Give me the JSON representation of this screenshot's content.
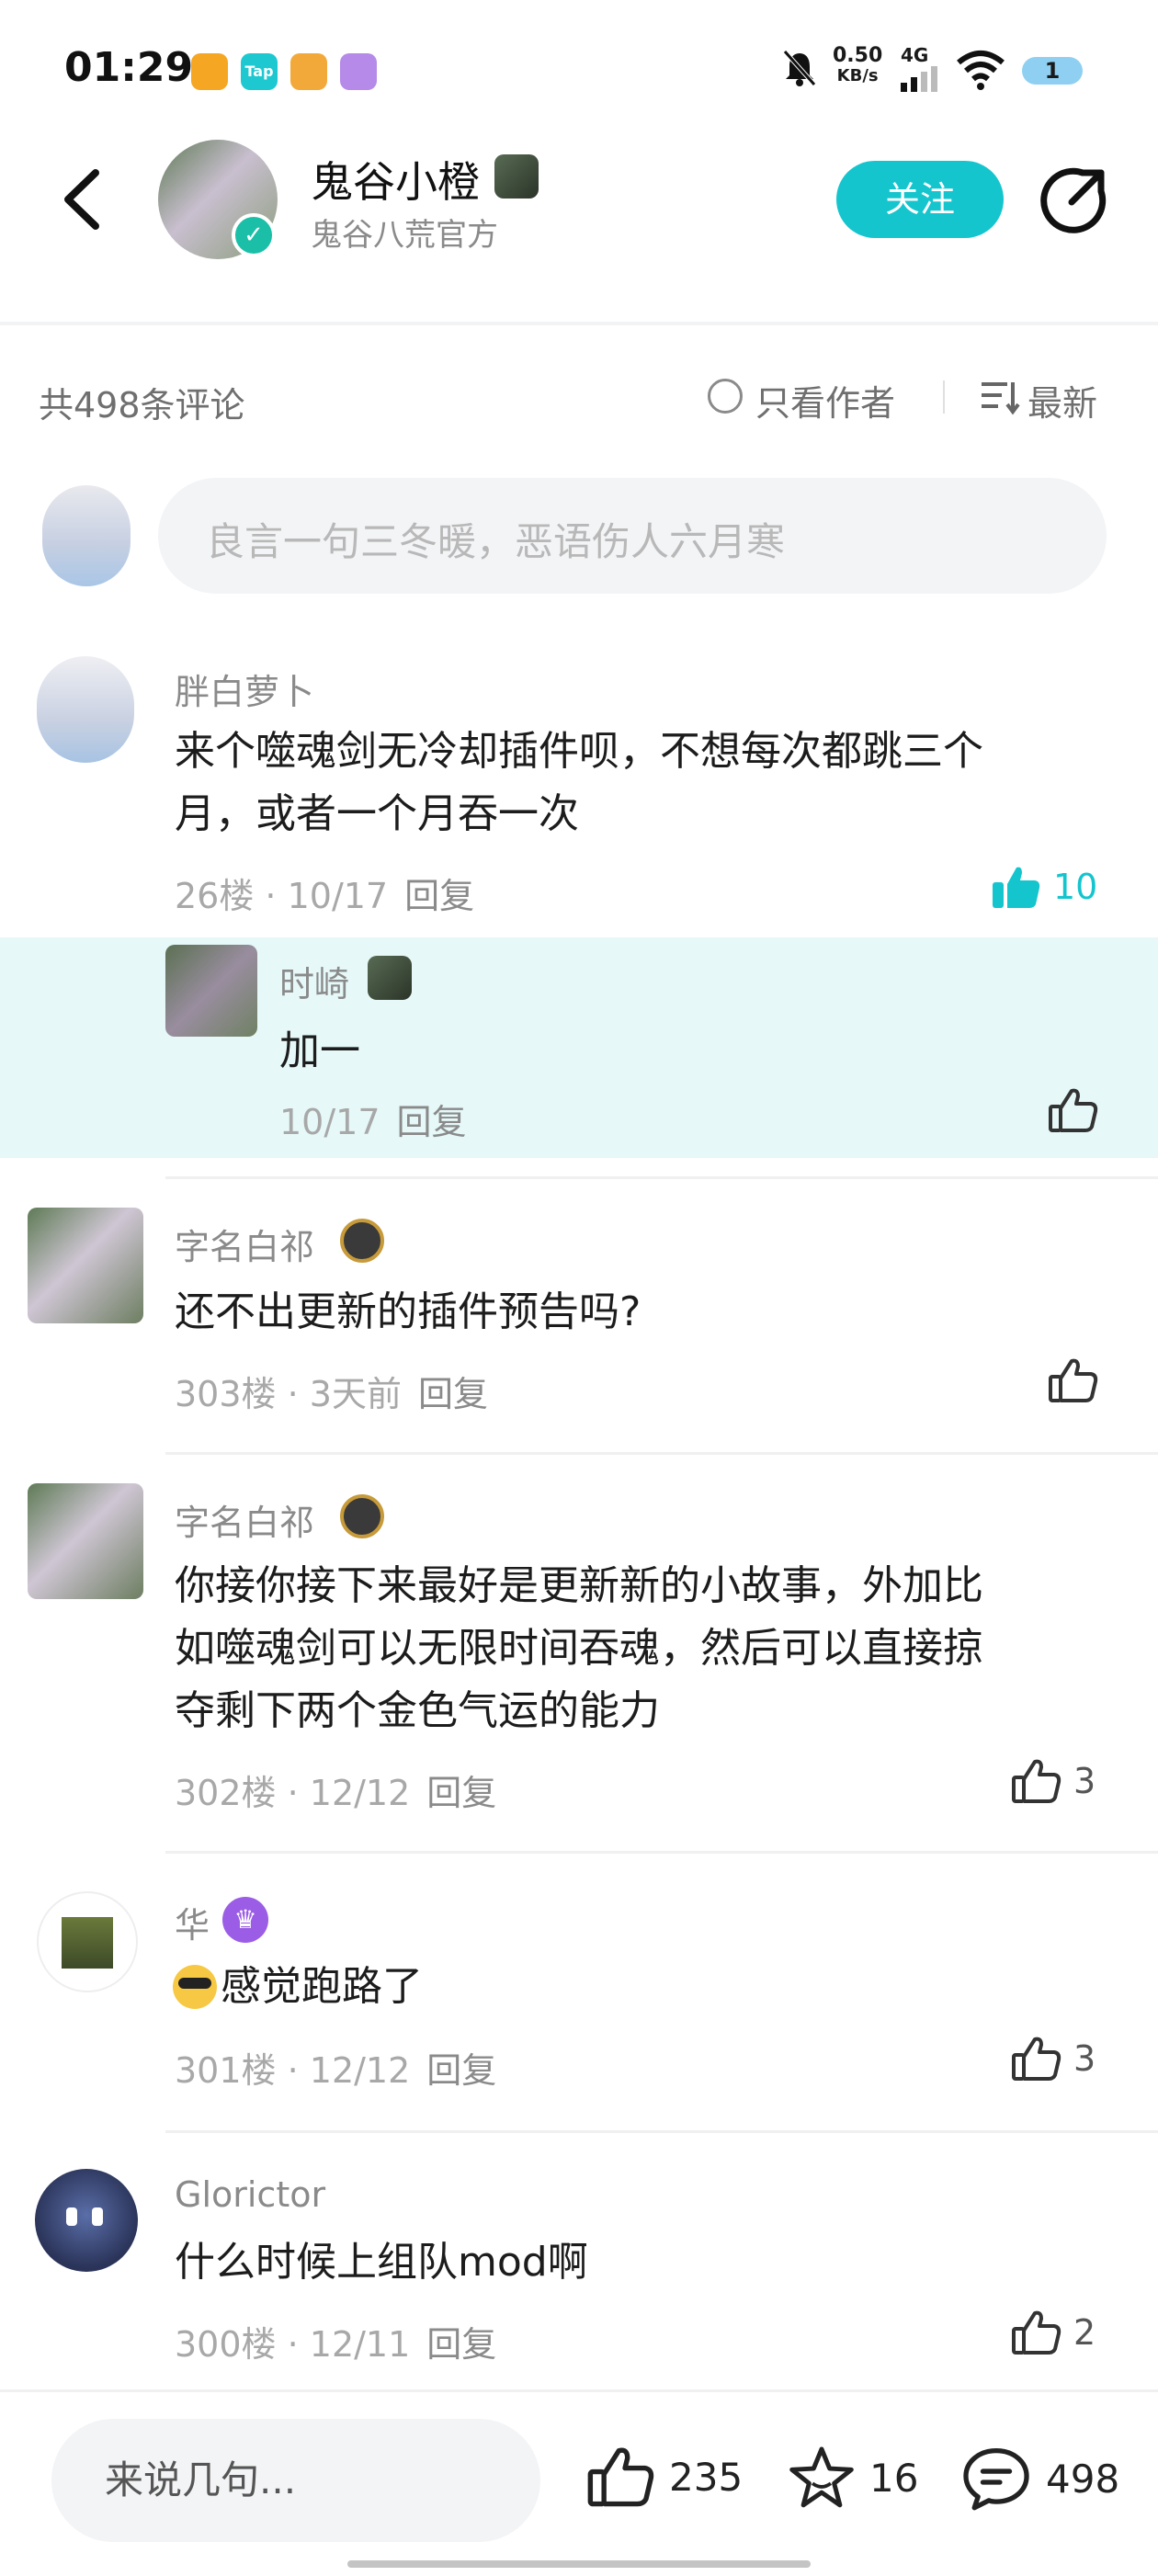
{
  "status_bar": {
    "time": "01:29",
    "net_speed_top": "0.50",
    "net_speed_unit": "KB/s",
    "network": "4G",
    "battery": "1"
  },
  "header": {
    "author_name": "鬼谷小橙",
    "author_subtitle": "鬼谷八荒官方",
    "follow_label": "关注"
  },
  "toolbar": {
    "count_text": "共498条评论",
    "author_only": "只看作者",
    "sort_label": "最新"
  },
  "composer": {
    "placeholder": "良言一句三冬暖，恶语伤人六月寒"
  },
  "comments": [
    {
      "name": "胖白萝卜",
      "text_line1": "来个噬魂剑无冷却插件呗，不想每次都跳三个",
      "text_line2": "月，或者一个月吞一次",
      "floor_date": "26楼 · 10/17",
      "reply": "回复",
      "likes": "10",
      "reply_item": {
        "name": "时崎",
        "text": "加一",
        "date": "10/17",
        "reply": "回复"
      }
    },
    {
      "name": "字名白祁",
      "text_line1": "还不出更新的插件预告吗?",
      "floor_date": "303楼 · 3天前",
      "reply": "回复",
      "likes": ""
    },
    {
      "name": "字名白祁",
      "text_line1": "你接你接下来最好是更新新的小故事，外加比",
      "text_line2": "如噬魂剑可以无限时间吞魂，然后可以直接掠",
      "text_line3": "夺剩下两个金色气运的能力",
      "floor_date": "302楼 · 12/12",
      "reply": "回复",
      "likes": "3"
    },
    {
      "name": "华",
      "text_line1": "感觉跑路了",
      "floor_date": "301楼 · 12/12",
      "reply": "回复",
      "likes": "3"
    },
    {
      "name": "Glorictor",
      "text_line1": "什么时候上组队mod啊",
      "floor_date": "300楼 · 12/11",
      "reply": "回复",
      "likes": "2"
    }
  ],
  "bottom": {
    "input_placeholder": "来说几句...",
    "likes": "235",
    "favorites": "16",
    "comments": "498"
  },
  "colors": {
    "accent": "#15c5ce",
    "highlight_bg": "#e6f8f8"
  }
}
